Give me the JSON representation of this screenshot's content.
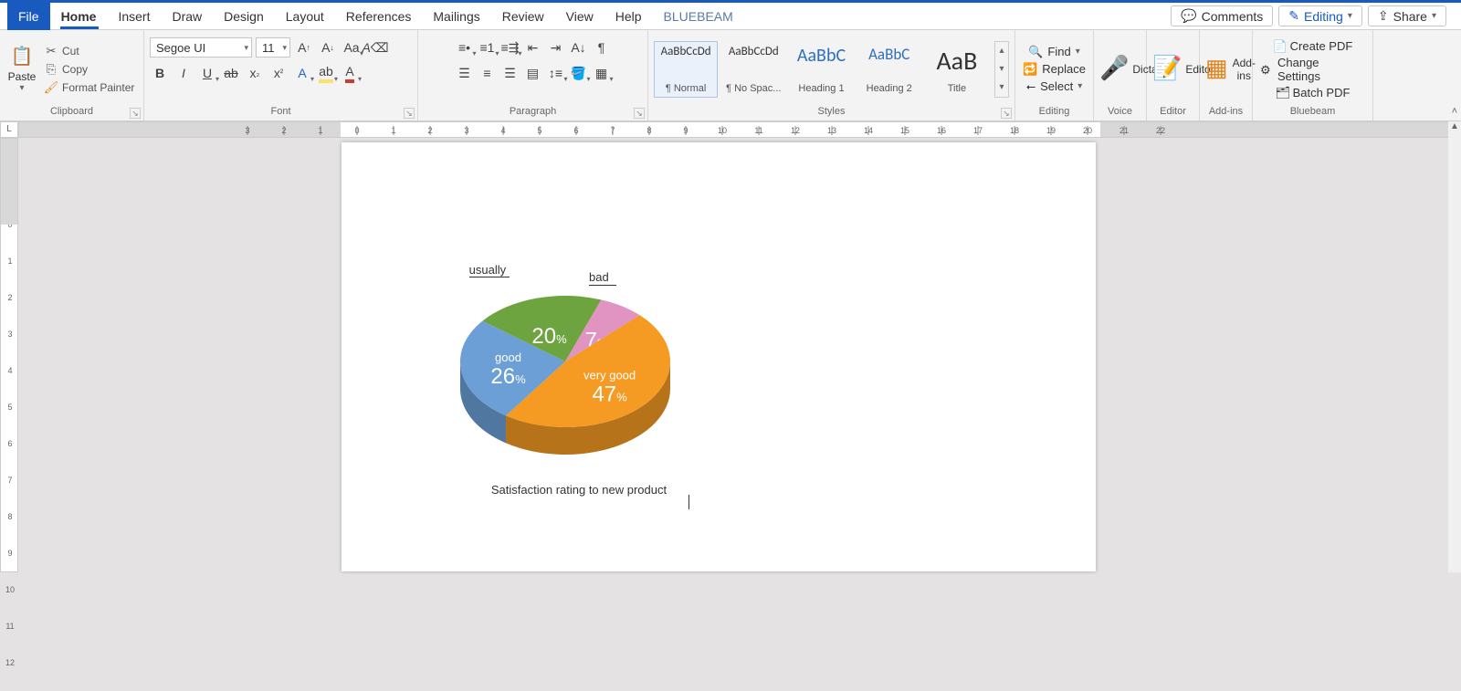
{
  "tabs": {
    "file": "File",
    "home": "Home",
    "insert": "Insert",
    "draw": "Draw",
    "design": "Design",
    "layout": "Layout",
    "references": "References",
    "mailings": "Mailings",
    "review": "Review",
    "view": "View",
    "help": "Help",
    "bluebeam": "BLUEBEAM"
  },
  "top_right": {
    "comments": "Comments",
    "editing": "Editing",
    "share": "Share"
  },
  "clipboard": {
    "paste": "Paste",
    "cut": "Cut",
    "copy": "Copy",
    "format_painter": "Format Painter",
    "label": "Clipboard"
  },
  "font": {
    "name": "Segoe UI",
    "size": "11",
    "label": "Font"
  },
  "paragraph": {
    "label": "Paragraph"
  },
  "styles": {
    "label": "Styles",
    "items": [
      {
        "preview": "AaBbCcDd",
        "name": "¶ Normal",
        "size": "13px"
      },
      {
        "preview": "AaBbCcDd",
        "name": "¶ No Spac...",
        "size": "13px"
      },
      {
        "preview": "AaBbC",
        "name": "Heading 1",
        "size": "20px",
        "color": "#2e6fbf"
      },
      {
        "preview": "AaBbC",
        "name": "Heading 2",
        "size": "17px",
        "color": "#2e6fbf"
      },
      {
        "preview": "AaB",
        "name": "Title",
        "size": "28px"
      }
    ]
  },
  "editing_grp": {
    "find": "Find",
    "replace": "Replace",
    "select": "Select",
    "label": "Editing"
  },
  "voice": {
    "dictate": "Dictate",
    "label": "Voice"
  },
  "editor": {
    "editor": "Editor",
    "label": "Editor"
  },
  "addins": {
    "addins": "Add-ins",
    "label": "Add-ins"
  },
  "bluebeam_grp": {
    "create": "Create PDF",
    "change": "Change Settings",
    "batch": "Batch PDF",
    "label": "Bluebeam"
  },
  "ruler_corner": "L",
  "chart_data": {
    "type": "pie",
    "title": "Satisfaction rating to new product",
    "series": [
      {
        "name": "very good",
        "value": 47,
        "color": "#f59a22"
      },
      {
        "name": "good",
        "value": 26,
        "color": "#6b9fd6"
      },
      {
        "name": "usually",
        "value": 20,
        "color": "#6ea43f"
      },
      {
        "name": "bad",
        "value": 7,
        "color": "#e193c2"
      }
    ],
    "callouts": {
      "usually": "usually",
      "bad": "bad"
    }
  }
}
